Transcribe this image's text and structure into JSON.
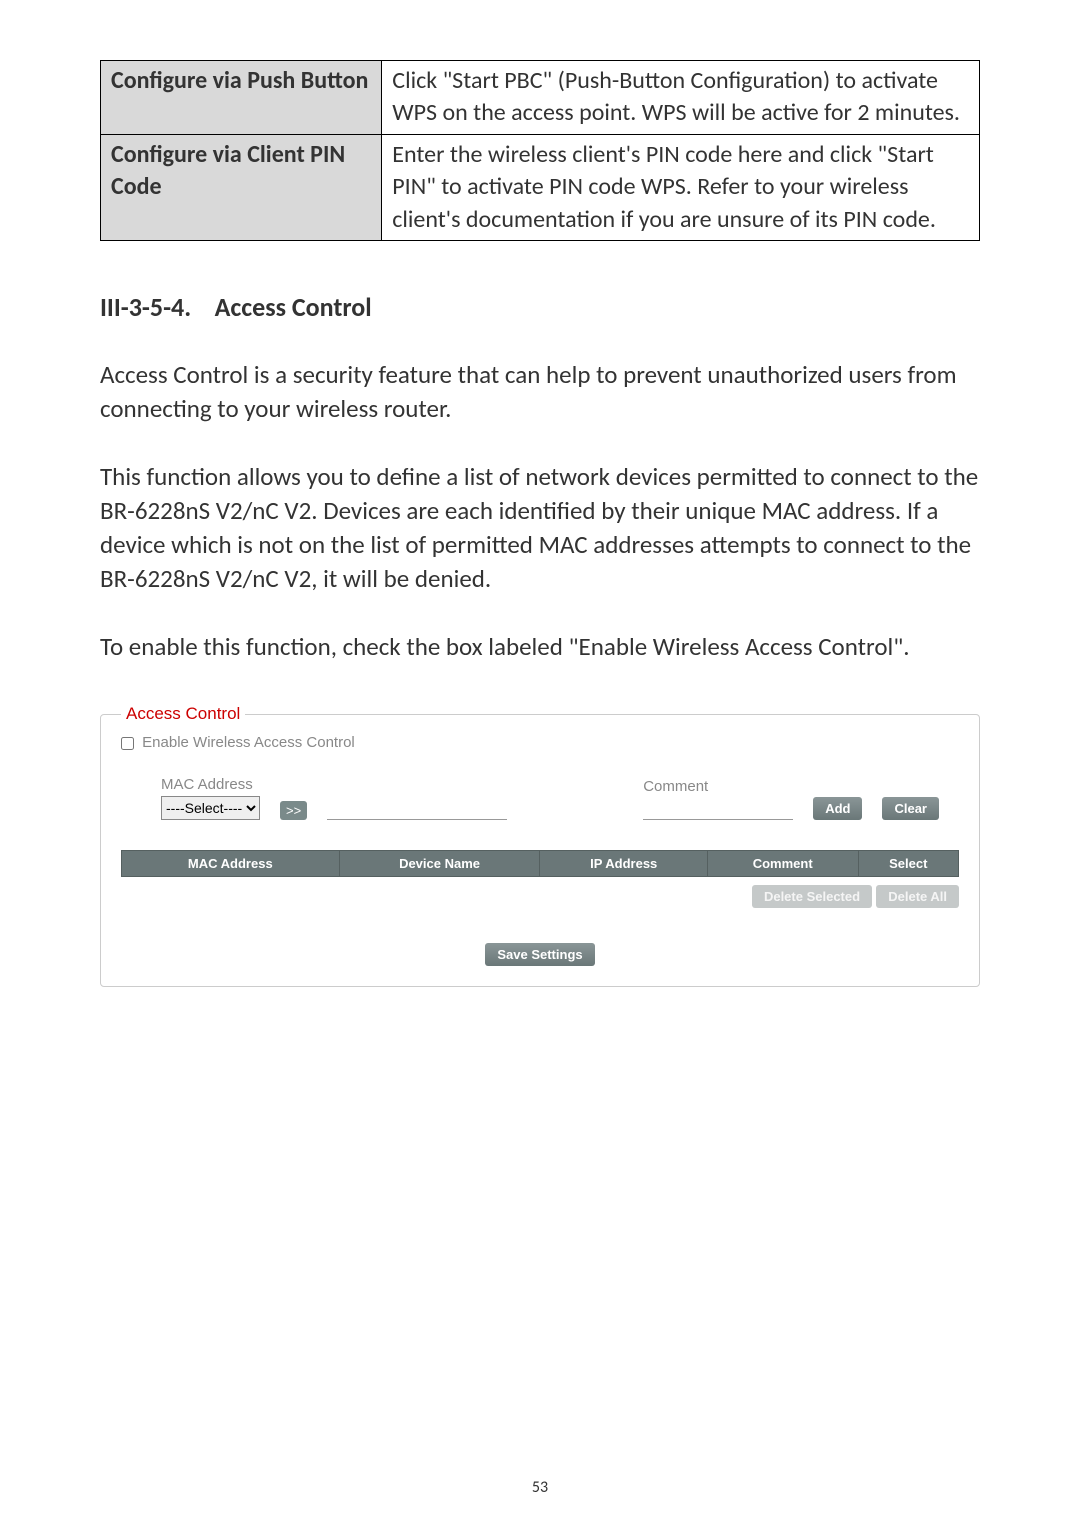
{
  "config_table": {
    "rows": [
      {
        "label": "Configure via Push Button",
        "desc": "Click \"Start PBC\" (Push-Button Configuration) to activate WPS on the access point. WPS will be active for 2 minutes."
      },
      {
        "label": "Configure via Client PIN Code",
        "desc": "Enter the wireless client's PIN code here and click \"Start PIN\" to activate PIN code WPS. Refer to your wireless client's documentation if you are unsure of its PIN code."
      }
    ]
  },
  "section": {
    "number": "III-3-5-4.",
    "title": "Access Control"
  },
  "paragraphs": {
    "p1": "Access Control is a security feature that can help to prevent unauthorized users from connecting to your wireless router.",
    "p2": "This function allows you to define a list of network devices permitted to connect to the BR-6228nS V2/nC V2. Devices are each identified by their unique MAC address. If a device which is not on the list of permitted MAC addresses attempts to connect to the BR-6228nS V2/nC V2, it will be denied.",
    "p3": "To enable this function, check the box labeled \"Enable Wireless Access Control\"."
  },
  "ac_panel": {
    "legend": "Access Control",
    "enable_label": "Enable Wireless Access Control",
    "mac_label": "MAC Address",
    "select_placeholder": "----Select----",
    "transfer_btn": ">>",
    "comment_label": "Comment",
    "add_btn": "Add",
    "clear_btn": "Clear",
    "headers": {
      "mac": "MAC Address",
      "device": "Device Name",
      "ip": "IP Address",
      "comment": "Comment",
      "select": "Select"
    },
    "delete_selected": "Delete Selected",
    "delete_all": "Delete All",
    "save": "Save Settings"
  },
  "page_number": "53"
}
